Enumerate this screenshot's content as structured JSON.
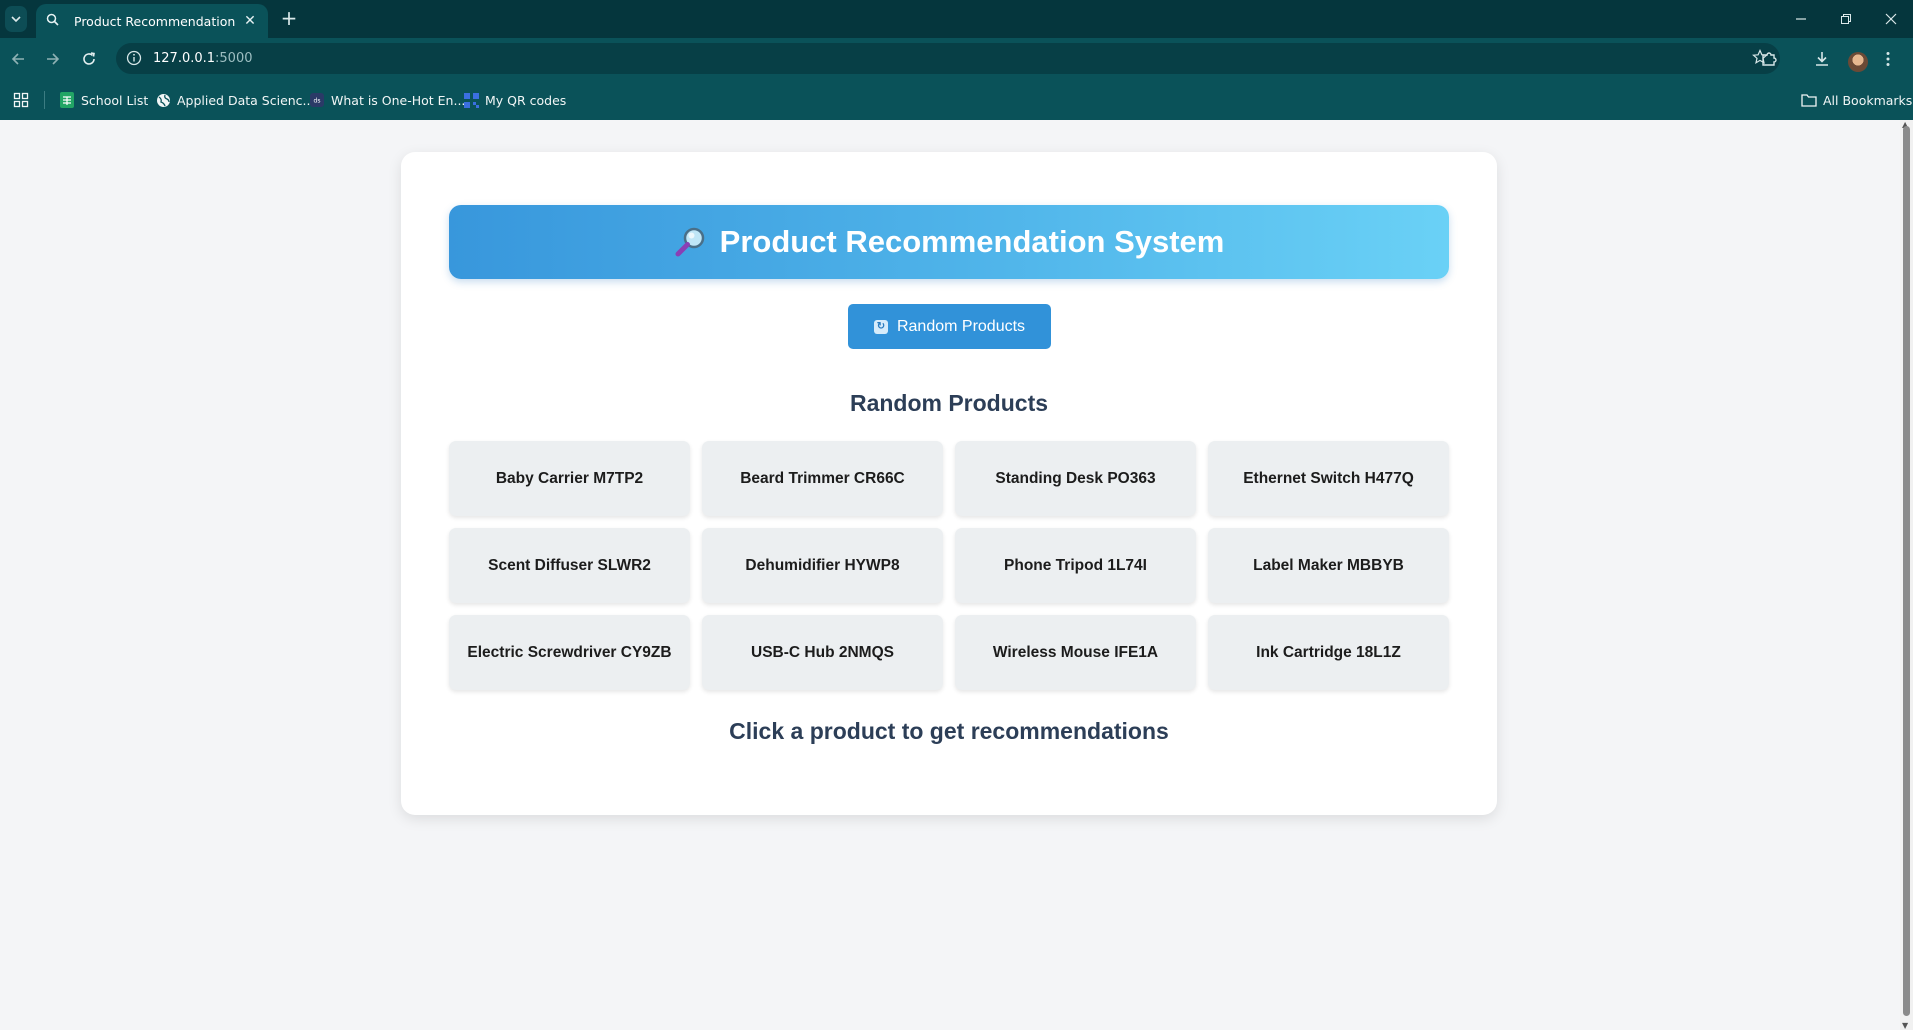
{
  "browser": {
    "tab": {
      "title": "Product Recommendation"
    },
    "address": {
      "host": "127.0.0.1",
      "port": ":5000"
    },
    "bookmarks": [
      {
        "label": "School List",
        "icon": "sheets-icon"
      },
      {
        "label": "Applied Data Scienc...",
        "icon": "globe-icon"
      },
      {
        "label": "What is One-Hot En...",
        "icon": "site-icon"
      },
      {
        "label": "My QR codes",
        "icon": "qr-icon"
      }
    ],
    "all_bookmarks_label": "All Bookmarks"
  },
  "page": {
    "title": "Product Recommendation System",
    "random_button_label": "Random Products",
    "section_title": "Random Products",
    "products": [
      "Baby Carrier M7TP2",
      "Beard Trimmer CR66C",
      "Standing Desk PO363",
      "Ethernet Switch H477Q",
      "Scent Diffuser SLWR2",
      "Dehumidifier HYWP8",
      "Phone Tripod 1L74I",
      "Label Maker MBBYB",
      "Electric Screwdriver CY9ZB",
      "USB-C Hub 2NMQS",
      "Wireless Mouse IFE1A",
      "Ink Cartridge 18L1Z"
    ],
    "hint": "Click a product to get recommendations"
  },
  "colors": {
    "chrome_dark": "#05363d",
    "chrome": "#0a5259",
    "banner_start": "#3897dc",
    "banner_end": "#6ad1f6",
    "button": "#3192d9",
    "heading": "#2c3e57"
  }
}
